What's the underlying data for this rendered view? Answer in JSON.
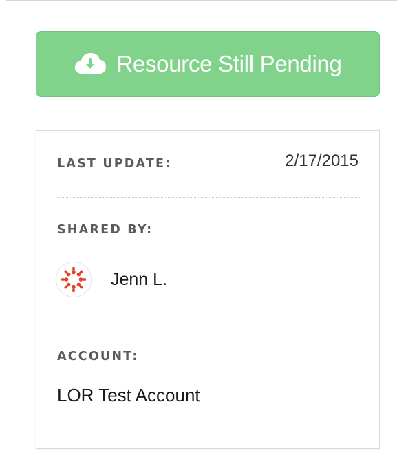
{
  "action_button": {
    "icon": "cloud-download-icon",
    "label": "Resource Still Pending",
    "color": "#81d38b"
  },
  "details": {
    "last_update": {
      "label": "LAST UPDATE:",
      "value": "2/17/2015"
    },
    "shared_by": {
      "label": "SHARED BY:",
      "avatar_icon": "canvas-logo-icon",
      "avatar_color": "#e2412c",
      "name": "Jenn L."
    },
    "account": {
      "label": "ACCOUNT:",
      "value": "LOR Test Account"
    }
  }
}
